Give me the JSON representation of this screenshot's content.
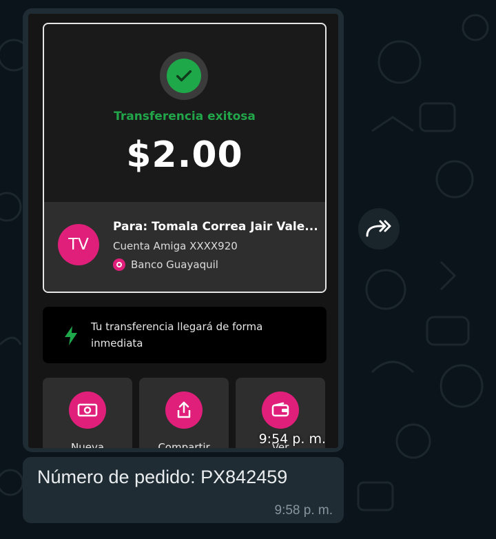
{
  "receipt": {
    "status_text": "Transferencia exitosa",
    "amount": "$2.00",
    "recipient": {
      "initials": "TV",
      "name": "Para: Tomala Correa Jair Vale...",
      "account": "Cuenta Amiga XXXX920",
      "bank": "Banco Guayaquil"
    },
    "info_text": "Tu transferencia llegará de forma inmediata",
    "actions": [
      {
        "label": "Nueva",
        "icon": "cash-icon"
      },
      {
        "label": "Compartir",
        "icon": "share-icon"
      },
      {
        "label": "Ver",
        "icon": "wallet-icon"
      }
    ]
  },
  "image_message": {
    "time": "9:54 p. m."
  },
  "text_message": {
    "text": "Número de pedido: PX842459",
    "time": "9:58 p. m."
  },
  "colors": {
    "accent": "#e01f7a",
    "success": "#22a64a",
    "bubble": "#202c33",
    "background": "#0b141a"
  }
}
